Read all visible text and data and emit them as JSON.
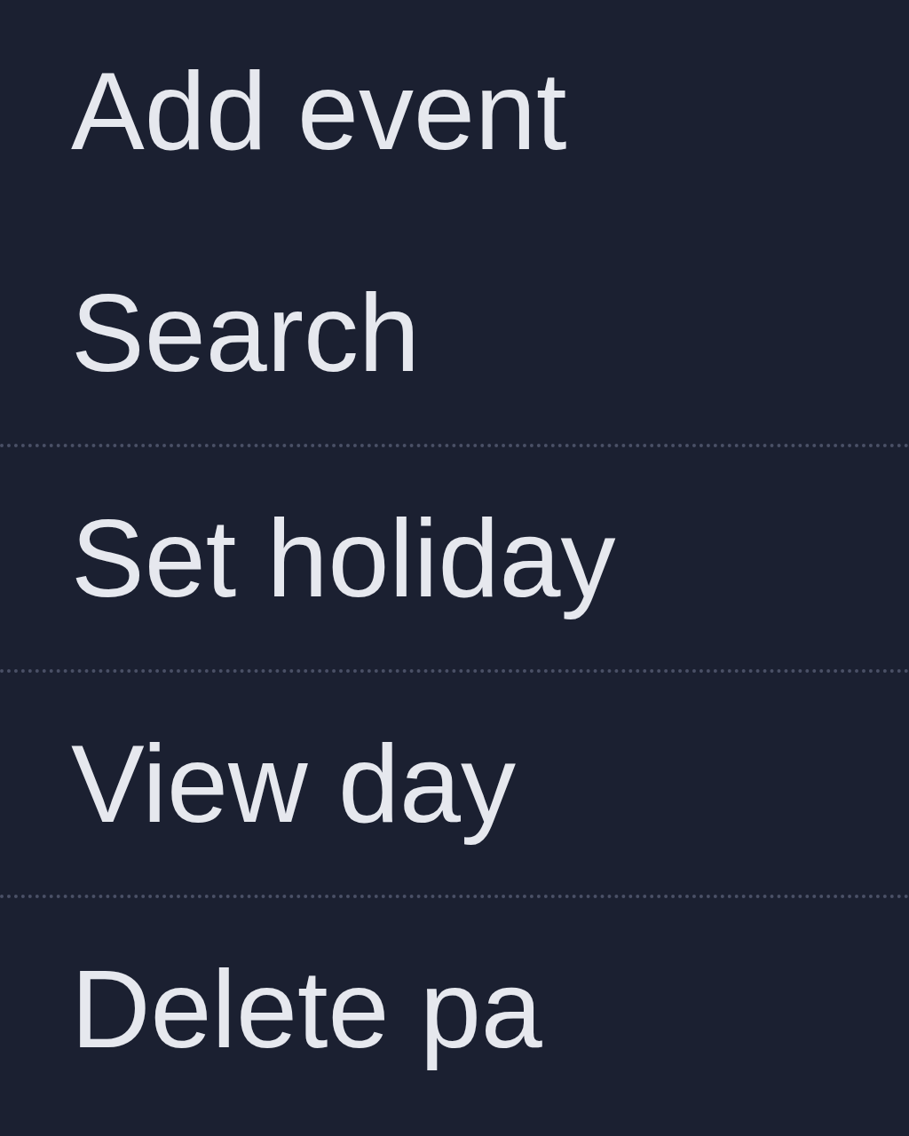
{
  "menu": {
    "items": [
      {
        "label": "Add event",
        "separator_before": false
      },
      {
        "label": "Search",
        "separator_before": false
      },
      {
        "label": "Set holiday",
        "separator_before": true
      },
      {
        "label": "View day",
        "separator_before": true
      },
      {
        "label": "Delete pa",
        "separator_before": true
      }
    ]
  }
}
